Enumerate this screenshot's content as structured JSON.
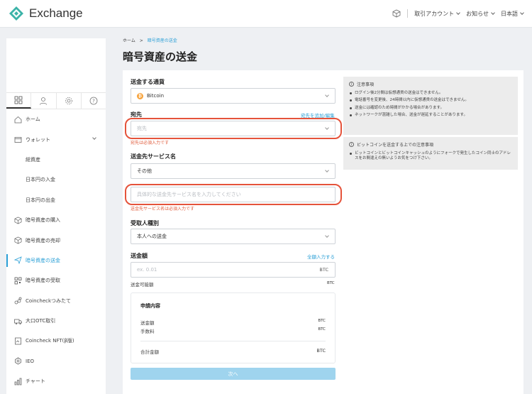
{
  "header": {
    "logo_text": "Exchange",
    "nav": [
      {
        "label": "取引アカウント"
      },
      {
        "label": "お知らせ"
      },
      {
        "label": "日本語"
      }
    ]
  },
  "sidebar": {
    "tabs": [
      "home-tab",
      "account-tab",
      "settings-tab",
      "help-tab"
    ],
    "items": [
      {
        "label": "ホーム",
        "icon": "home-icon"
      },
      {
        "label": "ウォレット",
        "icon": "wallet-icon"
      },
      {
        "label": "総資産"
      },
      {
        "label": "日本円の入金"
      },
      {
        "label": "日本円の出金"
      },
      {
        "label": "暗号資産の購入",
        "icon": "cube-icon"
      },
      {
        "label": "暗号資産の売却",
        "icon": "cube-icon"
      },
      {
        "label": "暗号資産の送金",
        "icon": "send-icon"
      },
      {
        "label": "暗号資産の受取",
        "icon": "qr-icon"
      },
      {
        "label": "Coincheckつみたて",
        "icon": "coins-icon"
      },
      {
        "label": "大口OTC取引",
        "icon": "truck-icon"
      },
      {
        "label": "Coincheck NFT(β版)",
        "icon": "nft-icon"
      },
      {
        "label": "IEO",
        "icon": "ieo-icon"
      },
      {
        "label": "チャート",
        "icon": "chart-icon"
      }
    ]
  },
  "breadcrumb": {
    "home": "ホーム",
    "sep": ">",
    "current": "暗号資産の送金"
  },
  "page_title": "暗号資産の送金",
  "form": {
    "currency_label": "送金する通貨",
    "currency_value": "Bitcoin",
    "dest_label": "宛先",
    "dest_link": "宛先を追加/編集",
    "dest_placeholder": "宛先",
    "dest_error": "宛先は必須入力です",
    "service_label": "送金先サービス名",
    "service_value": "その他",
    "service_placeholder": "具体的な送金先サービス名を入力してください",
    "service_error": "送金先サービス名は必須入力です",
    "recipient_label": "受取人種別",
    "recipient_value": "本人への送金",
    "amount_label": "送金額",
    "amount_link": "全額入力する",
    "amount_placeholder": "ex. 0.01",
    "amount_unit": "BTC",
    "available_label": "送金可能額",
    "available_unit": "BTC",
    "next_button": "次へ"
  },
  "summary": {
    "title": "申請内容",
    "rows": [
      {
        "label": "送金額",
        "unit": "BTC"
      },
      {
        "label": "手数料",
        "unit": "BTC"
      }
    ],
    "total_label": "合計金額",
    "total_unit": "BTC"
  },
  "notes": [
    {
      "title": "注意事項",
      "items": [
        "ログイン後2分間は仮想通貨の送金はできません。",
        "電話番号を変更後、24時間以内に仮想通貨の送金はできません。",
        "送金には確認のため時間がかかる場合があります。",
        "ネットワークが混雑した場合、送金が遅延することがあります。"
      ]
    },
    {
      "title": "ビットコインを送金する上での注意事項",
      "items": [
        "ビットコインとビットコインキャッシュのようにフォークで発生したコイン同士のアドレスをお間違えの無いようお気をつけ下さい。"
      ]
    }
  ]
}
